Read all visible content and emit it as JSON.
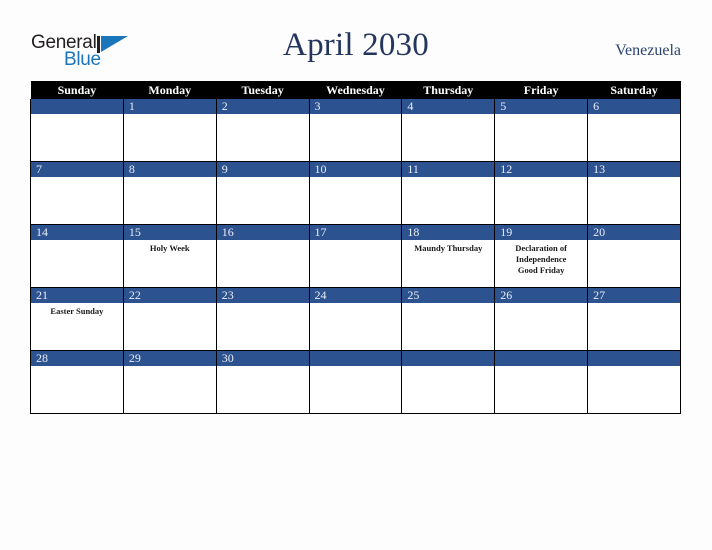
{
  "brand": {
    "name_part1": "General",
    "name_part2": "Blue",
    "logo_icon": "triangle-logo-icon"
  },
  "header": {
    "title": "April 2030",
    "country": "Venezuela"
  },
  "calendar": {
    "month": "April",
    "year": "2030",
    "weekday_headers": [
      "Sunday",
      "Monday",
      "Tuesday",
      "Wednesday",
      "Thursday",
      "Friday",
      "Saturday"
    ],
    "weeks": [
      [
        {
          "day": "",
          "events": []
        },
        {
          "day": "1",
          "events": []
        },
        {
          "day": "2",
          "events": []
        },
        {
          "day": "3",
          "events": []
        },
        {
          "day": "4",
          "events": []
        },
        {
          "day": "5",
          "events": []
        },
        {
          "day": "6",
          "events": []
        }
      ],
      [
        {
          "day": "7",
          "events": []
        },
        {
          "day": "8",
          "events": []
        },
        {
          "day": "9",
          "events": []
        },
        {
          "day": "10",
          "events": []
        },
        {
          "day": "11",
          "events": []
        },
        {
          "day": "12",
          "events": []
        },
        {
          "day": "13",
          "events": []
        }
      ],
      [
        {
          "day": "14",
          "events": []
        },
        {
          "day": "15",
          "events": [
            "Holy Week"
          ]
        },
        {
          "day": "16",
          "events": []
        },
        {
          "day": "17",
          "events": []
        },
        {
          "day": "18",
          "events": [
            "Maundy Thursday"
          ]
        },
        {
          "day": "19",
          "events": [
            "Declaration of Independence",
            "Good Friday"
          ]
        },
        {
          "day": "20",
          "events": []
        }
      ],
      [
        {
          "day": "21",
          "events": [
            "Easter Sunday"
          ]
        },
        {
          "day": "22",
          "events": []
        },
        {
          "day": "23",
          "events": []
        },
        {
          "day": "24",
          "events": []
        },
        {
          "day": "25",
          "events": []
        },
        {
          "day": "26",
          "events": []
        },
        {
          "day": "27",
          "events": []
        }
      ],
      [
        {
          "day": "28",
          "events": []
        },
        {
          "day": "29",
          "events": []
        },
        {
          "day": "30",
          "events": []
        },
        {
          "day": "",
          "events": []
        },
        {
          "day": "",
          "events": []
        },
        {
          "day": "",
          "events": []
        },
        {
          "day": "",
          "events": []
        }
      ]
    ]
  },
  "colors": {
    "header_bar": "#000000",
    "day_bar": "#2d5290",
    "title_text": "#24355e",
    "country_text": "#2c4470",
    "brand_blue": "#1b75bb",
    "brand_dark": "#231f20",
    "page_background": "#fdfdfd",
    "cell_background": "#ffffff",
    "grid_line": "#000000"
  }
}
